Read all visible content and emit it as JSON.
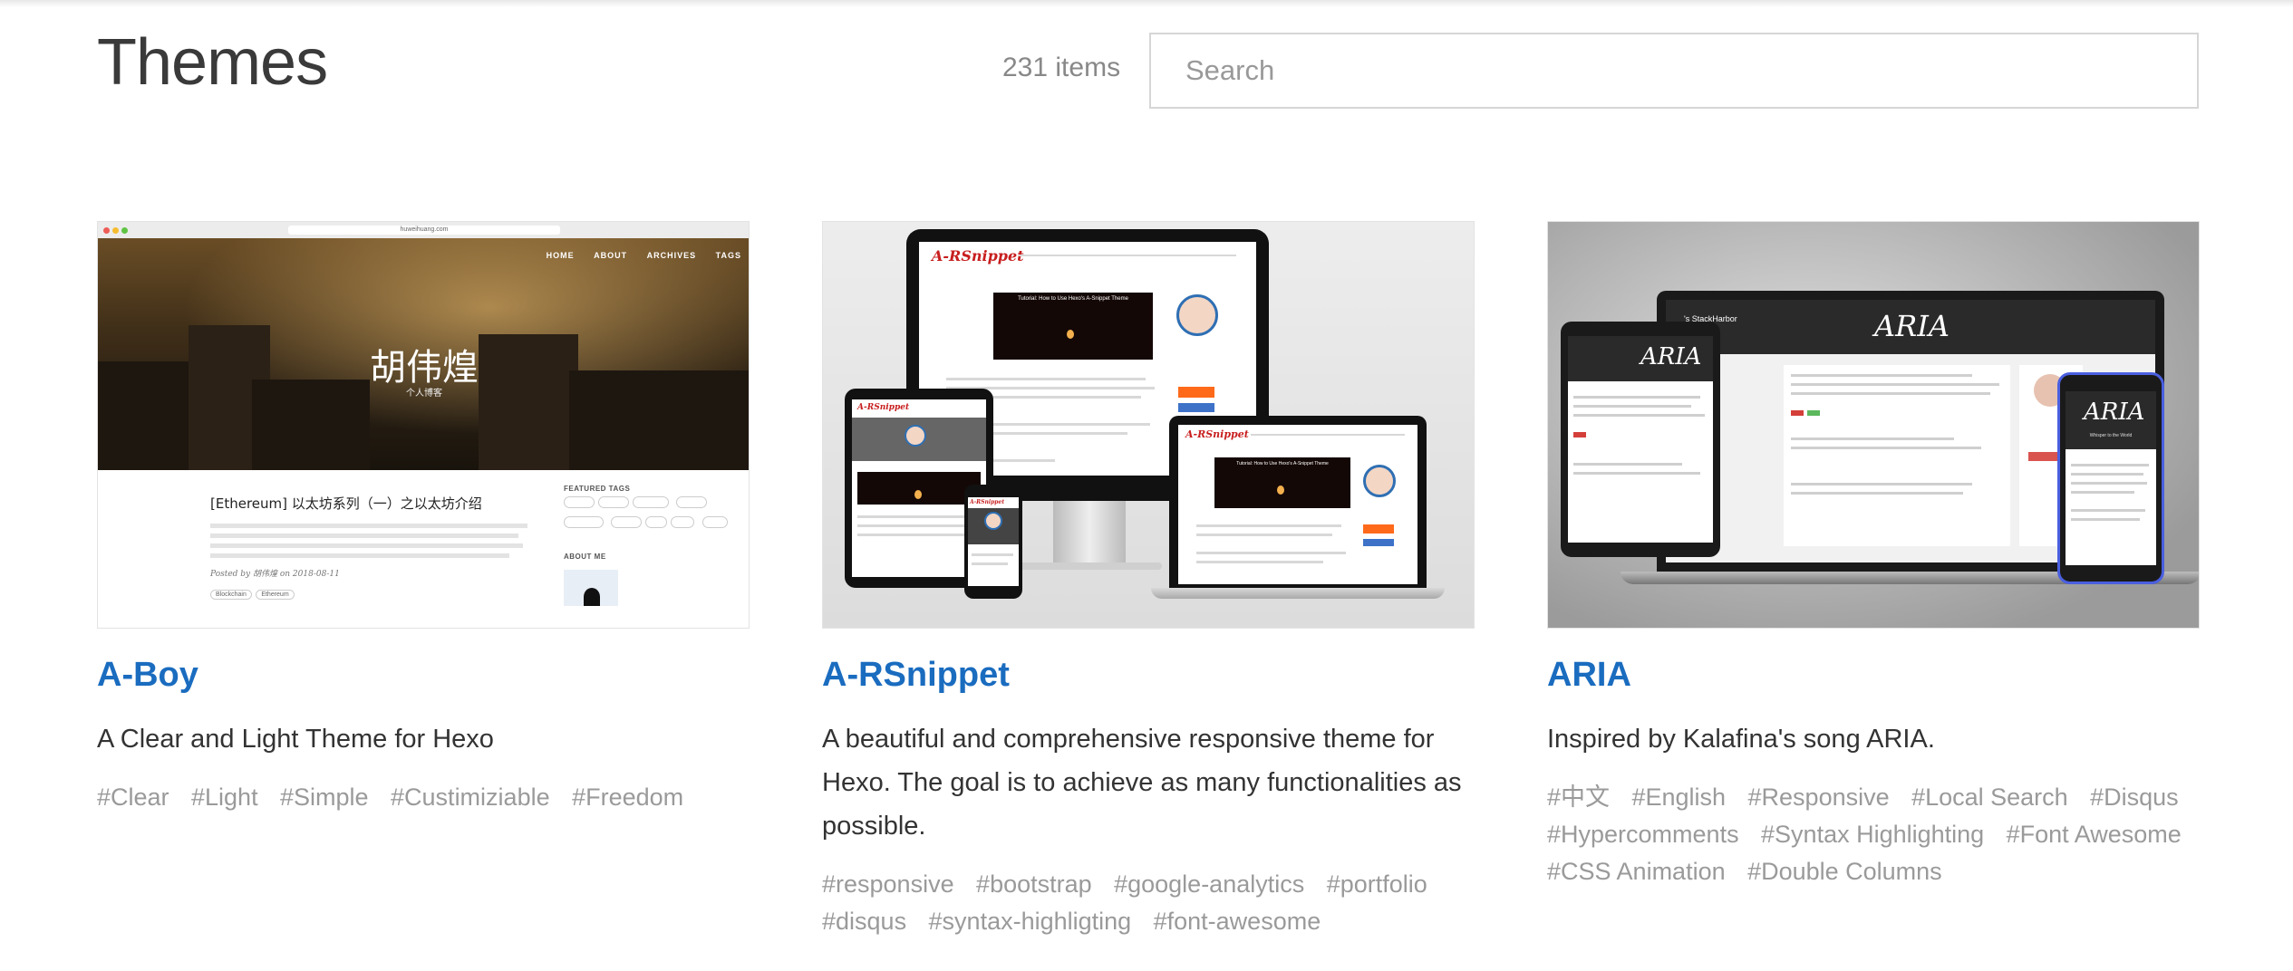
{
  "header": {
    "title": "Themes",
    "item_count": "231 items",
    "search_placeholder": "Search"
  },
  "themes": [
    {
      "name": "A-Boy",
      "description": "A Clear and Light Theme for Hexo",
      "tags": [
        "#Clear",
        "#Light",
        "#Simple",
        "#Custimiziable",
        "#Freedom"
      ],
      "preview": {
        "url": "huweihuang.com",
        "nav": [
          "HOME",
          "ABOUT",
          "ARCHIVES",
          "TAGS"
        ],
        "hero_title": "胡伟煌",
        "hero_subtitle": "个人博客",
        "post_title": "[Ethereum] 以太坊系列（一）之以太坊介绍",
        "post_meta": "Posted by 胡伟煌 on 2018-08-11",
        "post_tags": [
          "Blockchain",
          "Ethereum"
        ],
        "sidebar_heading": "FEATURED TAGS",
        "sidebar_heading2": "ABOUT ME"
      }
    },
    {
      "name": "A-RSnippet",
      "description": "A beautiful and comprehensive responsive theme for Hexo. The goal is to achieve as many functionalities as possible.",
      "tags": [
        "#responsive",
        "#bootstrap",
        "#google-analytics",
        "#portfolio",
        "#disqus",
        "#syntax-highligting",
        "#font-awesome"
      ],
      "preview": {
        "logo": "A-RSnippet",
        "video_caption": "Tutorial: How to Use Hexo's A-Snippet Theme"
      }
    },
    {
      "name": "ARIA",
      "description": "Inspired by Kalafina's song ARIA.",
      "tags": [
        "#中文",
        "#English",
        "#Responsive",
        "#Local Search",
        "#Disqus",
        "#Hypercomments",
        "#Syntax Highlighting",
        "#Font Awesome",
        "#CSS Animation",
        "#Double Columns"
      ],
      "preview": {
        "logo": "ARIA",
        "site_name": "'s StackHarbor",
        "tagline": "Whisper to the World"
      }
    }
  ]
}
